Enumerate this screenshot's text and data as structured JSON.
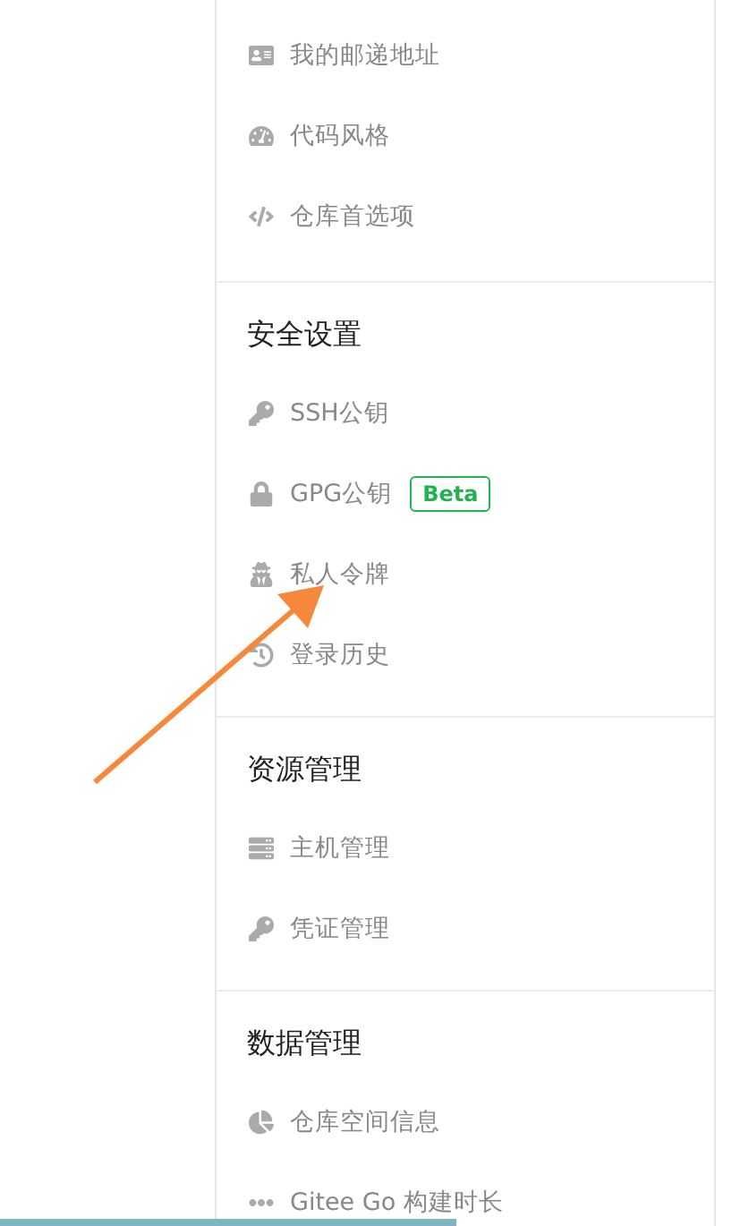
{
  "sections": [
    {
      "items": [
        {
          "label": "我的邮递地址"
        },
        {
          "label": "代码风格"
        },
        {
          "label": "仓库首选项"
        }
      ]
    },
    {
      "title": "安全设置",
      "items": [
        {
          "label": "SSH公钥"
        },
        {
          "label": "GPG公钥",
          "badge": "Beta"
        },
        {
          "label": "私人令牌"
        },
        {
          "label": "登录历史"
        }
      ]
    },
    {
      "title": "资源管理",
      "items": [
        {
          "label": "主机管理"
        },
        {
          "label": "凭证管理"
        }
      ]
    },
    {
      "title": "数据管理",
      "items": [
        {
          "label": "仓库空间信息"
        },
        {
          "label": "Gitee Go 构建时长"
        }
      ]
    }
  ]
}
